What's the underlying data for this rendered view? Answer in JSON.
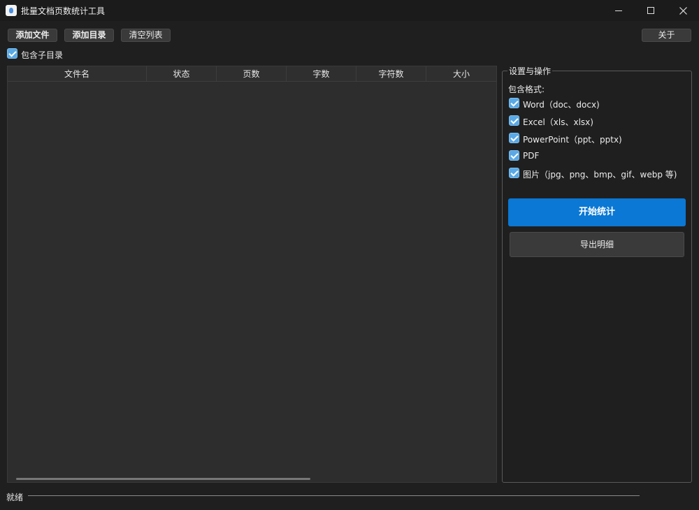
{
  "window": {
    "title": "批量文档页数统计工具"
  },
  "toolbar": {
    "add_files": "添加文件",
    "add_folder": "添加目录",
    "clear_list": "清空列表",
    "about": "关于"
  },
  "include_subdirs": {
    "label": "包含子目录",
    "checked": true
  },
  "table": {
    "columns": [
      "文件名",
      "状态",
      "页数",
      "字数",
      "字符数",
      "大小"
    ],
    "rows": []
  },
  "settings": {
    "group_title": "设置与操作",
    "formats_label": "包含格式:",
    "formats": [
      {
        "label": "Word（doc、docx)",
        "checked": true
      },
      {
        "label": "Excel（xls、xlsx)",
        "checked": true
      },
      {
        "label": "PowerPoint（ppt、pptx)",
        "checked": true
      },
      {
        "label": "PDF",
        "checked": true
      },
      {
        "label": "图片（jpg、png、bmp、gif、webp 等)",
        "checked": true
      }
    ],
    "start_button": "开始统计",
    "export_button": "导出明细"
  },
  "status": {
    "text": "就绪"
  },
  "colors": {
    "accent": "#0a78d4",
    "checkbox": "#5aa9e6",
    "background": "#1f1f1f"
  },
  "icons": [
    "app-icon",
    "minimize-icon",
    "maximize-icon",
    "close-icon",
    "checkmark-icon"
  ]
}
